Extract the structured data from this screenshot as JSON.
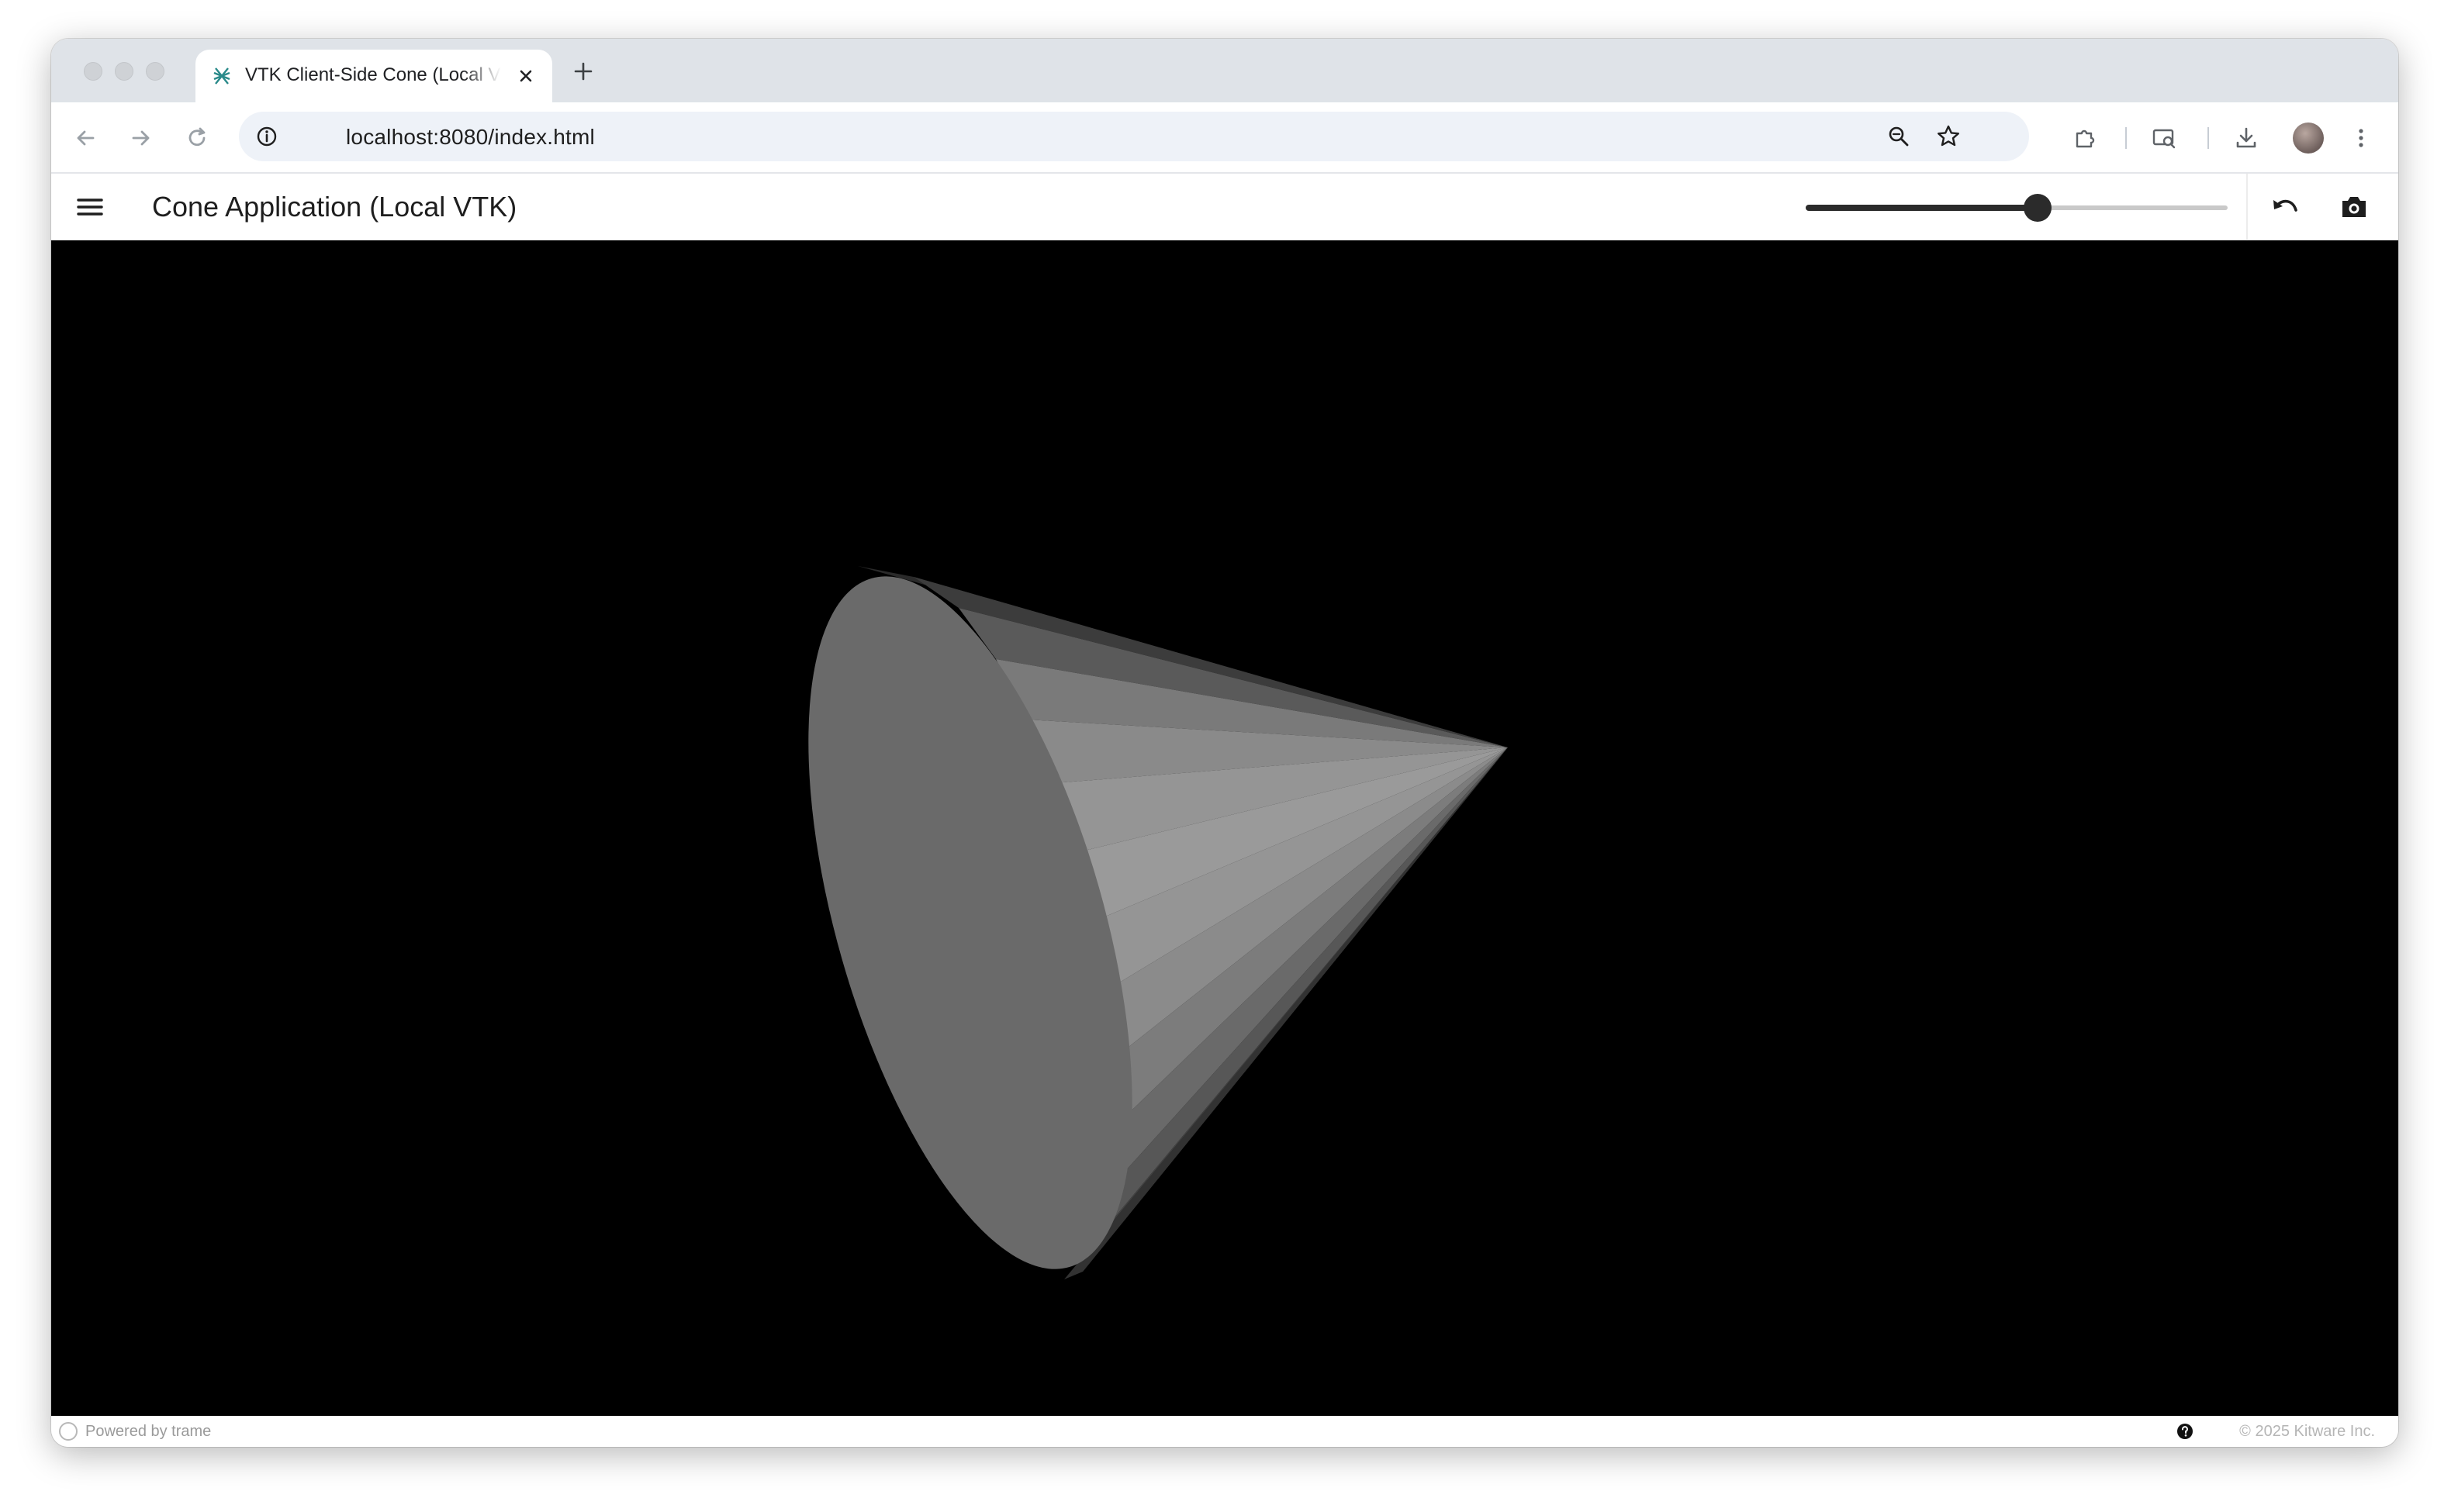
{
  "browser": {
    "tab": {
      "title": "VTK Client-Side Cone (Local VTK)",
      "favicon": "trame-logo-icon"
    },
    "url": "localhost:8080/index.html"
  },
  "app": {
    "title": "Cone Application (Local VTK)",
    "resolution_slider": {
      "fraction": 0.55
    }
  },
  "viewport": {
    "background": "#000000",
    "object": "cone"
  },
  "footer": {
    "powered_by": "Powered by trame",
    "copyright": "© 2025 Kitware Inc."
  }
}
